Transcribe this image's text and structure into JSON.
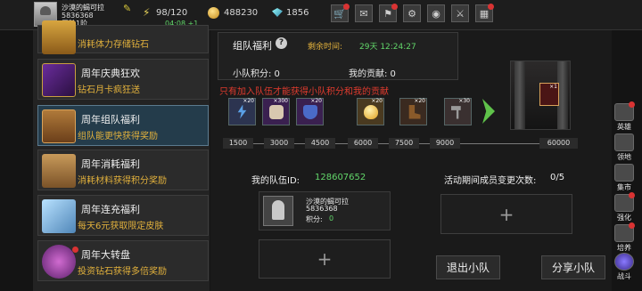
{
  "player": {
    "name": "沙漠的蝎可拉",
    "id": "5836368",
    "rank": "冒险1阶",
    "stamina": "98/120",
    "timer": "04:08 +1",
    "gold": "488230",
    "gems": "1856"
  },
  "toolbar": {
    "icons": [
      "shop-icon",
      "mail-icon",
      "task-icon",
      "settings-icon",
      "color-wheel-icon",
      "battle-icon",
      "map-icon"
    ]
  },
  "events": [
    {
      "title": "",
      "desc": "消耗体力存储钻石",
      "icon": "chest-gold-icon"
    },
    {
      "title": "周年庆典狂欢",
      "desc": "钻石月卡疯狂送",
      "icon": "purple-card-icon"
    },
    {
      "title": "周年组队福利",
      "desc": "组队能更快获得奖励",
      "icon": "treasure-chest-icon"
    },
    {
      "title": "周年消耗福利",
      "desc": "消耗材料获得积分奖励",
      "icon": "open-chest-icon"
    },
    {
      "title": "周年连充福利",
      "desc": "每天6元获取限定皮肤",
      "icon": "crystal-icon"
    },
    {
      "title": "周年大转盘",
      "desc": "投资钻石获得多倍奖励",
      "icon": "wheel-icon"
    }
  ],
  "welfare": {
    "title": "组队福利",
    "remain_label": "剩余时间:",
    "remain_time": "29天 12:24:27",
    "team_score": "小队积分: 0",
    "my_contrib": "我的贡献: 0",
    "warning": "只有加入队伍才能获得小队积分和我的贡献"
  },
  "rewards": [
    {
      "count": "×20",
      "icon": "lightning-scroll-icon"
    },
    {
      "count": "×300",
      "icon": "bone-icon"
    },
    {
      "count": "×20",
      "icon": "blue-shield-icon"
    },
    {
      "count": "×20",
      "icon": "egg-icon"
    },
    {
      "count": "×20",
      "icon": "boot-icon"
    },
    {
      "count": "×30",
      "icon": "hammer-icon"
    }
  ],
  "boss_card_count": "×1",
  "milestones": [
    "1500",
    "3000",
    "4500",
    "6000",
    "7500",
    "9000",
    "60000"
  ],
  "team": {
    "id_label": "我的队伍ID:",
    "id": "128607652",
    "changes_label": "活动期间成员变更次数:",
    "changes": "0/5",
    "member_name": "沙漠的蝎可拉",
    "member_id": "5836368",
    "member_score_label": "积分:",
    "member_score": "0",
    "plus": "+"
  },
  "buttons": {
    "leave": "退出小队",
    "share": "分享小队"
  },
  "right_nav": [
    {
      "label": "英雄",
      "icon": "hero-icon",
      "dot": true
    },
    {
      "label": "领地",
      "icon": "territory-icon",
      "dot": false
    },
    {
      "label": "集市",
      "icon": "market-icon",
      "dot": false
    },
    {
      "label": "强化",
      "icon": "enhance-icon",
      "dot": true
    },
    {
      "label": "培养",
      "icon": "train-icon",
      "dot": true
    },
    {
      "label": "战斗",
      "icon": "battle-portal-icon",
      "dot": false
    }
  ]
}
